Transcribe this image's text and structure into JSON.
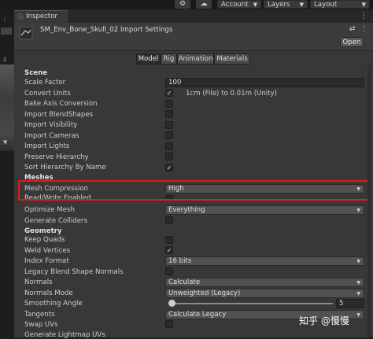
{
  "topbar": {
    "icon_1": "cloud-settings-icon",
    "icon_2": "cloud-icon",
    "account_label": "Account",
    "layers_label": "Layers",
    "layout_label": "Layout"
  },
  "inspector_tab": {
    "label": "Inspector",
    "icon": "info-icon"
  },
  "header": {
    "title": "SM_Env_Bone_Skull_02 Import Settings",
    "open_label": "Open",
    "icons": [
      "help-icon",
      "settings-icon",
      "more-icon"
    ]
  },
  "tabs": [
    {
      "label": "Model",
      "active": true
    },
    {
      "label": "Rig",
      "active": false
    },
    {
      "label": "Animation",
      "active": false
    },
    {
      "label": "Materials",
      "active": false
    }
  ],
  "scene": {
    "section_label": "Scene",
    "scale_factor_label": "Scale Factor",
    "scale_factor_value": "100",
    "convert_units_label": "Convert Units",
    "convert_units_checked": true,
    "convert_units_text": "1cm (File) to 0.01m (Unity)",
    "bake_axis_label": "Bake Axis Conversion",
    "bake_axis_checked": false,
    "import_blendshapes_label": "Import BlendShapes",
    "import_blendshapes_checked": false,
    "import_visibility_label": "Import Visibility",
    "import_visibility_checked": false,
    "import_cameras_label": "Import Cameras",
    "import_cameras_checked": false,
    "import_lights_label": "Import Lights",
    "import_lights_checked": false,
    "preserve_hierarchy_label": "Preserve Hierarchy",
    "preserve_hierarchy_checked": false,
    "sort_hierarchy_label": "Sort Hierarchy By Name",
    "sort_hierarchy_checked": true
  },
  "meshes": {
    "section_label": "Meshes",
    "mesh_compression_label": "Mesh Compression",
    "mesh_compression_value": "High",
    "read_write_label": "Read/Write Enabled",
    "optimize_mesh_label": "Optimize Mesh",
    "optimize_mesh_value": "Everything",
    "generate_colliders_label": "Generate Colliders",
    "generate_colliders_checked": false
  },
  "geometry": {
    "section_label": "Geometry",
    "keep_quads_label": "Keep Quads",
    "keep_quads_checked": false,
    "weld_vertices_label": "Weld Vertices",
    "weld_vertices_checked": true,
    "index_format_label": "Index Format",
    "index_format_value": "16 bits",
    "legacy_blend_label": "Legacy Blend Shape Normals",
    "legacy_blend_checked": false,
    "normals_label": "Normals",
    "normals_value": "Calculate",
    "normals_mode_label": "Normals Mode",
    "normals_mode_value": "Unweighted (Legacy)",
    "smoothing_angle_label": "Smoothing Angle",
    "smoothing_angle_value": "5",
    "tangents_label": "Tangents",
    "tangents_value": "Calculate Legacy",
    "swap_uvs_label": "Swap UVs",
    "swap_uvs_checked": false,
    "generate_lightmap_label": "Generate Lightmap UVs"
  },
  "left_strip": {
    "label_1": "z"
  },
  "watermark": "知乎 @慢慢",
  "colors": {
    "highlight": "#d91e1e",
    "panel_bg": "#383838",
    "checkbox_bg": "#2a2a2a"
  }
}
